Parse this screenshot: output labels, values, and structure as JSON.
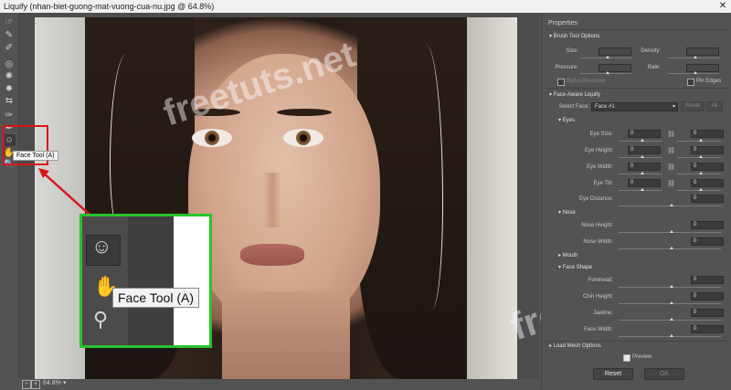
{
  "window": {
    "title": "Liquify (nhan-biet-guong-mat-vuong-cua-nu.jpg @ 64.8%)",
    "close": "✕"
  },
  "tools": [
    {
      "name": "forward-warp-icon",
      "glyph": "☞"
    },
    {
      "name": "reconstruct-icon",
      "glyph": "✎"
    },
    {
      "name": "smooth-icon",
      "glyph": "✐"
    },
    {
      "name": "twirl-icon",
      "glyph": "◎"
    },
    {
      "name": "pucker-icon",
      "glyph": "✺"
    },
    {
      "name": "bloat-icon",
      "glyph": "✹"
    },
    {
      "name": "push-left-icon",
      "glyph": "⇆"
    },
    {
      "name": "freeze-mask-icon",
      "glyph": "✑"
    },
    {
      "name": "thaw-mask-icon",
      "glyph": "✒"
    },
    {
      "name": "face-tool-icon",
      "glyph": "☺"
    },
    {
      "name": "hand-tool-icon",
      "glyph": "✋"
    },
    {
      "name": "zoom-tool-icon",
      "glyph": "🔍"
    }
  ],
  "tooltip": "Face Tool (A)",
  "zoom_callout": {
    "tooltip": "Face Tool (A)",
    "face_icon": "☺",
    "hand_icon": "✋",
    "zoom_icon": "⚲"
  },
  "watermark": "freetuts.net",
  "statusbar": {
    "minus": "−",
    "plus": "+",
    "zoom": "64.8%",
    "caret": "▾"
  },
  "properties": {
    "title": "Properties",
    "brush": {
      "header": "Brush Tool Options",
      "size_label": "Size:",
      "size_value": "",
      "density_label": "Density:",
      "density_value": "",
      "pressure_label": "Pressure:",
      "pressure_value": "",
      "rate_label": "Rate:",
      "rate_value": "",
      "stylus_label": "Stylus Pressure",
      "pin_edges_label": "Pin Edges"
    },
    "face_aware": {
      "header": "Face-Aware Liquify",
      "select_face_label": "Select Face:",
      "select_face_value": "Face #1",
      "reset": "Reset",
      "all": "All",
      "eyes": {
        "header": "Eyes",
        "rows": [
          {
            "label": "Eye Size:",
            "left": "0",
            "right": "0"
          },
          {
            "label": "Eye Height:",
            "left": "0",
            "right": "0"
          },
          {
            "label": "Eye Width:",
            "left": "0",
            "right": "0"
          },
          {
            "label": "Eye Tilt:",
            "left": "0",
            "right": "0"
          }
        ],
        "distance_label": "Eye Distance:",
        "distance_value": "0"
      },
      "nose": {
        "header": "Nose",
        "height_label": "Nose Height:",
        "height_value": "0",
        "width_label": "Nose Width:",
        "width_value": "0"
      },
      "mouth_header": "Mouth",
      "face_shape": {
        "header": "Face Shape",
        "forehead_label": "Forehead:",
        "forehead_value": "0",
        "chin_label": "Chin Height:",
        "chin_value": "0",
        "jawline_label": "Jawline:",
        "jawline_value": "0",
        "width_label": "Face Width:",
        "width_value": "0"
      }
    },
    "load_mesh": "Load Mesh Options",
    "preview_label": "Preview",
    "reset_button": "Reset",
    "ok_button": "OK"
  }
}
